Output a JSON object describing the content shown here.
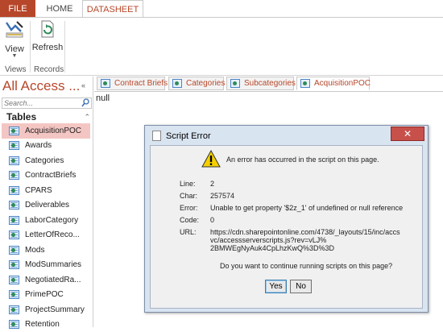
{
  "ribbon": {
    "tabs": [
      {
        "label": "FILE"
      },
      {
        "label": "HOME"
      },
      {
        "label": "DATASHEET"
      }
    ],
    "buttons": {
      "view_label": "View",
      "refresh_label": "Refresh"
    },
    "groups": {
      "views_label": "Views",
      "records_label": "Records"
    }
  },
  "nav": {
    "title": "All Access ...",
    "search_placeholder": "Search...",
    "section_label": "Tables",
    "items": [
      {
        "label": "AcquisitionPOC"
      },
      {
        "label": "Awards"
      },
      {
        "label": "Categories"
      },
      {
        "label": "ContractBriefs"
      },
      {
        "label": "CPARS"
      },
      {
        "label": "Deliverables"
      },
      {
        "label": "LaborCategory"
      },
      {
        "label": "LetterOfReco..."
      },
      {
        "label": "Mods"
      },
      {
        "label": "ModSummaries"
      },
      {
        "label": "NegotiatedRa..."
      },
      {
        "label": "PrimePOC"
      },
      {
        "label": "ProjectSummary"
      },
      {
        "label": "Retention"
      }
    ]
  },
  "doc_tabs": [
    {
      "label": "Contract Briefs"
    },
    {
      "label": "Categories"
    },
    {
      "label": "Subcategories"
    },
    {
      "label": "AcquisitionPOC"
    }
  ],
  "doc": {
    "content_text": "null"
  },
  "dialog": {
    "title": "Script Error",
    "close_glyph": "✕",
    "message": "An error has occurred in the script on this page.",
    "fields": {
      "line_label": "Line:",
      "line_value": "2",
      "char_label": "Char:",
      "char_value": "257574",
      "error_label": "Error:",
      "error_value": "Unable to get property '$2z_1' of undefined or null reference",
      "code_label": "Code:",
      "code_value": "0",
      "url_label": "URL:",
      "url_line1": "https://cdn.sharepointonline.com/4738/_layouts/15/inc/accs",
      "url_line2": "vc/accessserverscripts.js?rev=vLJ%",
      "url_line3": "2BMWEgNyAuk4CpLhzKwQ%3D%3D"
    },
    "question": "Do you want to continue running scripts on this page?",
    "yes_label": "Yes",
    "no_label": "No"
  },
  "colors": {
    "accent": "#b7472a",
    "dialog_frame": "#d9e4f1",
    "close_button": "#c7504b",
    "selected_item": "#f4c6c3"
  }
}
